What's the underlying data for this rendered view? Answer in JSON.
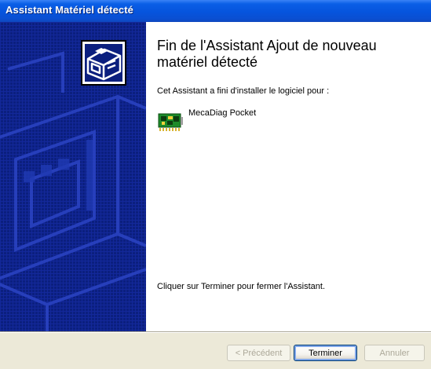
{
  "window": {
    "title": "Assistant Matériel détecté"
  },
  "main": {
    "heading": "Fin de l'Assistant Ajout de nouveau matériel détecté",
    "intro_text": "Cet Assistant a fini d'installer le logiciel pour :",
    "device": {
      "icon": "circuit-board-icon",
      "name": "MecaDiag Pocket"
    },
    "finish_text": "Cliquer sur Terminer pour fermer l'Assistant."
  },
  "sidebar": {
    "icon": "hardware-wizard-icon"
  },
  "buttons": {
    "previous": "< Précédent",
    "finish": "Terminer",
    "cancel": "Annuler"
  },
  "colors": {
    "titlebar": "#0654dd",
    "sidebar": "#0b1f7e",
    "footer": "#ece9d8"
  }
}
